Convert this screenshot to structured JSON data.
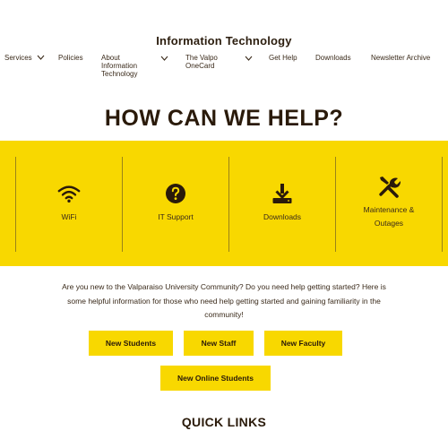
{
  "header": {
    "site_title": "Information Technology"
  },
  "nav": {
    "items": [
      {
        "label": "Services",
        "has_dropdown": true
      },
      {
        "label": "Policies",
        "has_dropdown": false
      },
      {
        "label": "About Information Technology",
        "has_dropdown": true
      },
      {
        "label": "The Valpo OneCard",
        "has_dropdown": true
      },
      {
        "label": "Get Help",
        "has_dropdown": false
      },
      {
        "label": "Downloads",
        "has_dropdown": false
      },
      {
        "label": "Newsletter Archive",
        "has_dropdown": false
      }
    ]
  },
  "hero": {
    "title": "HOW CAN WE HELP?"
  },
  "help_tiles": [
    {
      "label": "WiFi",
      "icon": "wifi-icon"
    },
    {
      "label": "IT Support",
      "icon": "question-circle-icon"
    },
    {
      "label": "Downloads",
      "icon": "download-icon"
    },
    {
      "label": "Maintenance & Outages",
      "icon": "tools-icon"
    }
  ],
  "intro": {
    "text": "Are you new to the Valparaiso University Community? Do you need help getting started? Here is some helpful information for those who need help getting started and gaining familiarity in the community!"
  },
  "audience_buttons": [
    {
      "label": "New Students"
    },
    {
      "label": "New Staff"
    },
    {
      "label": "New Faculty"
    },
    {
      "label": "New Online Students"
    }
  ],
  "quick_links": {
    "title": "QUICK LINKS"
  },
  "colors": {
    "accent_yellow": "#f8d800",
    "text_brown": "#3a2a1a",
    "heading_dark": "#2a1a0a"
  }
}
